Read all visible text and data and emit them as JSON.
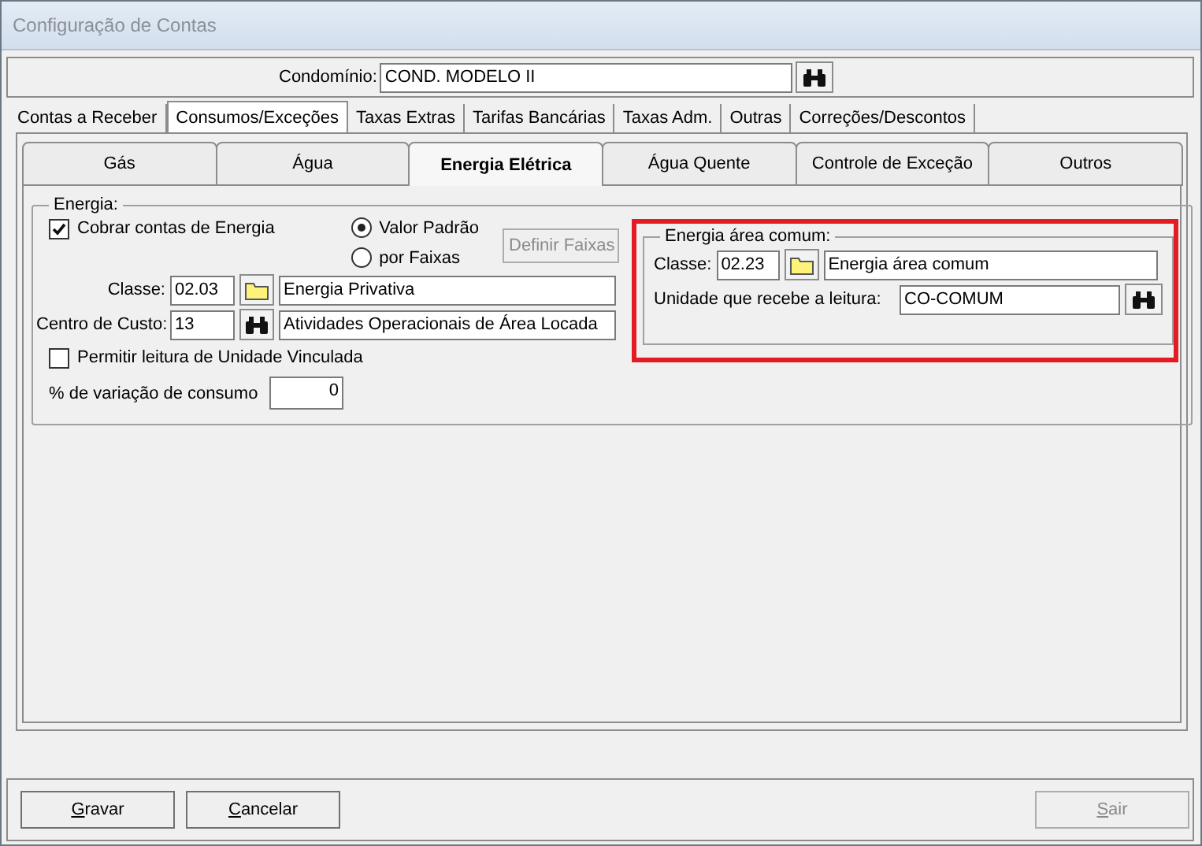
{
  "window": {
    "title": "Configuração de Contas"
  },
  "condominio": {
    "label": "Condomínio:",
    "value": "COND. MODELO II"
  },
  "tabs": [
    {
      "label": "Contas a Receber",
      "selected": false
    },
    {
      "label": "Consumos/Exceções",
      "selected": true
    },
    {
      "label": "Taxas Extras",
      "selected": false
    },
    {
      "label": "Tarifas Bancárias",
      "selected": false
    },
    {
      "label": "Taxas Adm.",
      "selected": false
    },
    {
      "label": "Outras",
      "selected": false
    },
    {
      "label": "Correções/Descontos",
      "selected": false
    }
  ],
  "subtabs": [
    {
      "label": "Gás",
      "selected": false
    },
    {
      "label": "Água",
      "selected": false
    },
    {
      "label": "Energia Elétrica",
      "selected": true
    },
    {
      "label": "Água Quente",
      "selected": false
    },
    {
      "label": "Controle de Exceção",
      "selected": false
    },
    {
      "label": "Outros",
      "selected": false
    }
  ],
  "energia": {
    "title": "Energia:",
    "charge": {
      "label": "Cobrar contas de Energia",
      "checked": true
    },
    "modes": [
      {
        "label": "Valor Padrão",
        "selected": true
      },
      {
        "label": "por Faixas",
        "selected": false
      }
    ],
    "define_button": {
      "label": "Definir Faixas",
      "disabled": true
    },
    "classe": {
      "label": "Classe:",
      "code": "02.03",
      "name": "Energia Privativa"
    },
    "centro": {
      "label": "Centro de Custo:",
      "code": "13",
      "name": "Atividades Operacionais de Área Locada"
    },
    "linked": {
      "label": "Permitir leitura de Unidade Vinculada",
      "checked": false
    },
    "variation": {
      "label": "% de variação de consumo",
      "value": "0"
    }
  },
  "common": {
    "title": "Energia área comum:",
    "highlighted": true,
    "classe": {
      "label": "Classe:",
      "code": "02.23",
      "name": "Energia área comum"
    },
    "unit": {
      "label": "Unidade que recebe a leitura:",
      "value": "CO-COMUM"
    }
  },
  "buttons": [
    {
      "label": "Gravar",
      "disabled": false
    },
    {
      "label": "Cancelar",
      "disabled": false
    },
    {
      "label": "Sair",
      "disabled": true
    }
  ]
}
